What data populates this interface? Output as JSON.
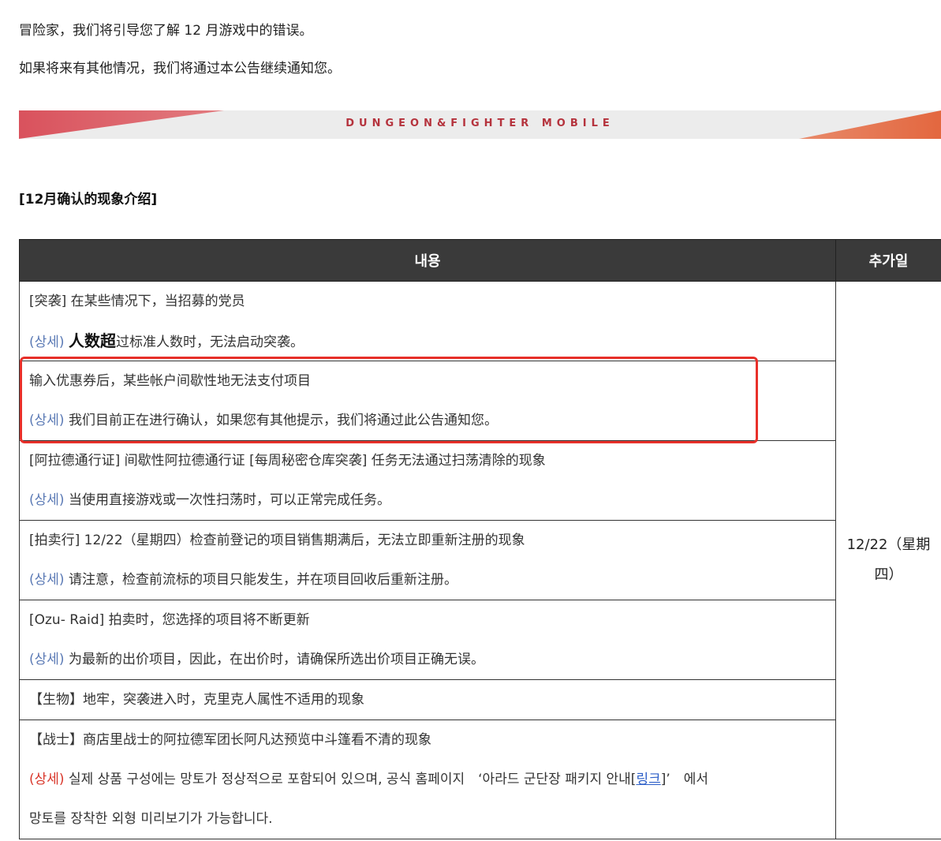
{
  "intro": {
    "line1": "冒险家，我们将引导您了解 12 月游戏中的错误。",
    "line2": "如果将来有其他情况，我们将通过本公告继续通知您。"
  },
  "banner": {
    "text": "DUNGEON&FIGHTER MOBILE"
  },
  "section_title": "[12月确认的现象介绍]",
  "table": {
    "headers": {
      "content": "내용",
      "date": "추가일"
    },
    "date_value": "12/22（星期四）",
    "rows": [
      {
        "line1": "[突袭] 在某些情况下，当招募的党员",
        "tag": "(상세)",
        "line2_big": "人数超",
        "line2_rest": "过标准人数时，无法启动突袭。"
      },
      {
        "line1": "输入优惠券后，某些帐户间歇性地无法支付项目",
        "tag": "(상세)",
        "line2": "我们目前正在进行确认，如果您有其他提示，我们将通过此公告通知您。"
      },
      {
        "line1": "[阿拉德通行证] 间歇性阿拉德通行证 [每周秘密仓库突袭] 任务无法通过扫荡清除的现象",
        "tag": "(상세)",
        "line2": "当使用直接游戏或一次性扫荡时，可以正常完成任务。"
      },
      {
        "line1": "[拍卖行] 12/22（星期四）检查前登记的项目销售期满后，无法立即重新注册的现象",
        "tag": "(상세)",
        "line2": "请注意，检查前流标的项目只能发生，并在项目回收后重新注册。"
      },
      {
        "line1": "[Ozu- Raid] 拍卖时，您选择的项目将不断更新",
        "tag": "(상세)",
        "line2": "为最新的出价项目，因此，在出价时，请确保所选出价项目正确无误。"
      },
      {
        "line1": "【生物】地牢，突袭进入时，克里克人属性不适用的现象"
      },
      {
        "line1": "【战士】商店里战士的阿拉德军团长阿凡达预览中斗篷看不清的现象",
        "tag": "(상세)",
        "line2_pre": "실제 상품 구성에는 망토가 정상적으로 포함되어 있으며, 공식 홈페이지　‘아라드 군단장 패키지 안내[",
        "link": "링크",
        "line2_post": "]’　에서",
        "line3": "망토를 장착한 외형 미리보기가 가능합니다."
      }
    ]
  },
  "colors": {
    "highlight": "#e8302a",
    "tag": "#5b7ab5",
    "tag_red": "#d9372b",
    "header_bg": "#3a3a3a"
  }
}
